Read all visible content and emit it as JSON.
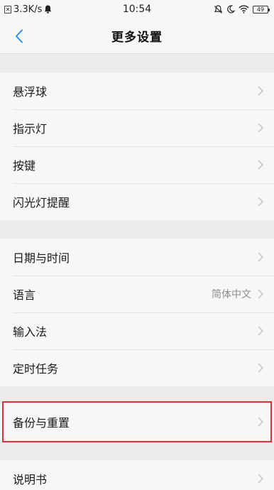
{
  "status_bar": {
    "sim_icon": "sim-card-icon",
    "network_speed": "3.3K/s",
    "time": "10:54",
    "battery_level": "49"
  },
  "nav": {
    "back_icon": "chevron-left-icon",
    "title": "更多设置"
  },
  "groups": [
    {
      "items": [
        {
          "label": "悬浮球",
          "value": ""
        },
        {
          "label": "指示灯",
          "value": ""
        },
        {
          "label": "按键",
          "value": ""
        },
        {
          "label": "闪光灯提醒",
          "value": ""
        }
      ]
    },
    {
      "items": [
        {
          "label": "日期与时间",
          "value": ""
        },
        {
          "label": "语言",
          "value": "简体中文"
        },
        {
          "label": "输入法",
          "value": ""
        },
        {
          "label": "定时任务",
          "value": ""
        }
      ]
    },
    {
      "items": [
        {
          "label": "备份与重置",
          "value": ""
        }
      ]
    },
    {
      "items": [
        {
          "label": "说明书",
          "value": ""
        }
      ]
    }
  ],
  "colors": {
    "accent": "#2f8ee0",
    "highlight": "#d9343a",
    "background": "#ececec",
    "card": "#f7f7f7",
    "chevron": "#c4c4c4"
  }
}
